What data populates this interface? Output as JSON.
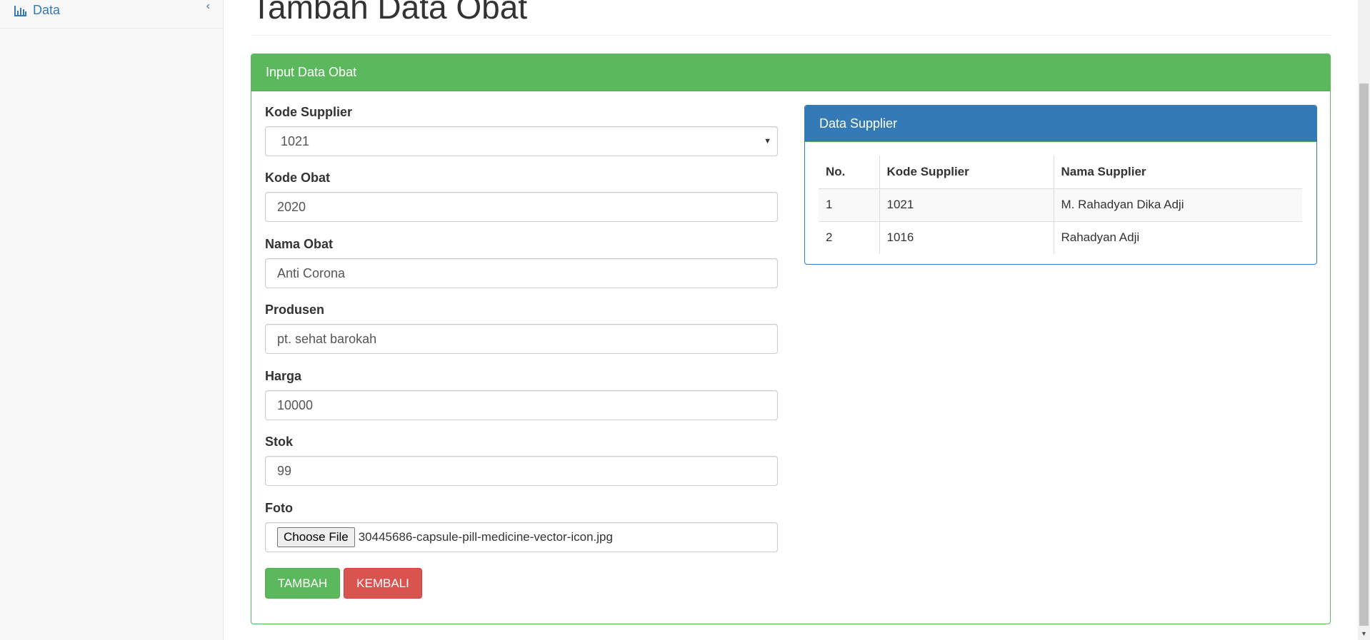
{
  "sidebar": {
    "items": [
      {
        "label": "Data",
        "icon": "bar-chart-icon",
        "expand_icon": "chevron-left-icon"
      }
    ]
  },
  "page": {
    "title": "Tambah Data Obat"
  },
  "form_panel": {
    "title": "Input Data Obat",
    "fields": {
      "kode_supplier": {
        "label": "Kode Supplier",
        "value": "1021"
      },
      "kode_obat": {
        "label": "Kode Obat",
        "value": "2020"
      },
      "nama_obat": {
        "label": "Nama Obat",
        "value": "Anti Corona"
      },
      "produsen": {
        "label": "Produsen",
        "value": "pt. sehat barokah"
      },
      "harga": {
        "label": "Harga",
        "value": "10000"
      },
      "stok": {
        "label": "Stok",
        "value": "99"
      },
      "foto": {
        "label": "Foto",
        "button": "Choose File",
        "file_name": "30445686-capsule-pill-medicine-vector-icon.jpg"
      }
    },
    "buttons": {
      "submit": "TAMBAH",
      "back": "KEMBALI"
    }
  },
  "supplier_panel": {
    "title": "Data Supplier",
    "columns": [
      "No.",
      "Kode Supplier",
      "Nama Supplier"
    ],
    "rows": [
      [
        "1",
        "1021",
        "M. Rahadyan Dika Adji"
      ],
      [
        "2",
        "1016",
        "Rahadyan Adji"
      ]
    ]
  },
  "colors": {
    "success": "#5cb85c",
    "danger": "#d9534f",
    "primary": "#337ab7",
    "link": "#337ab7"
  }
}
